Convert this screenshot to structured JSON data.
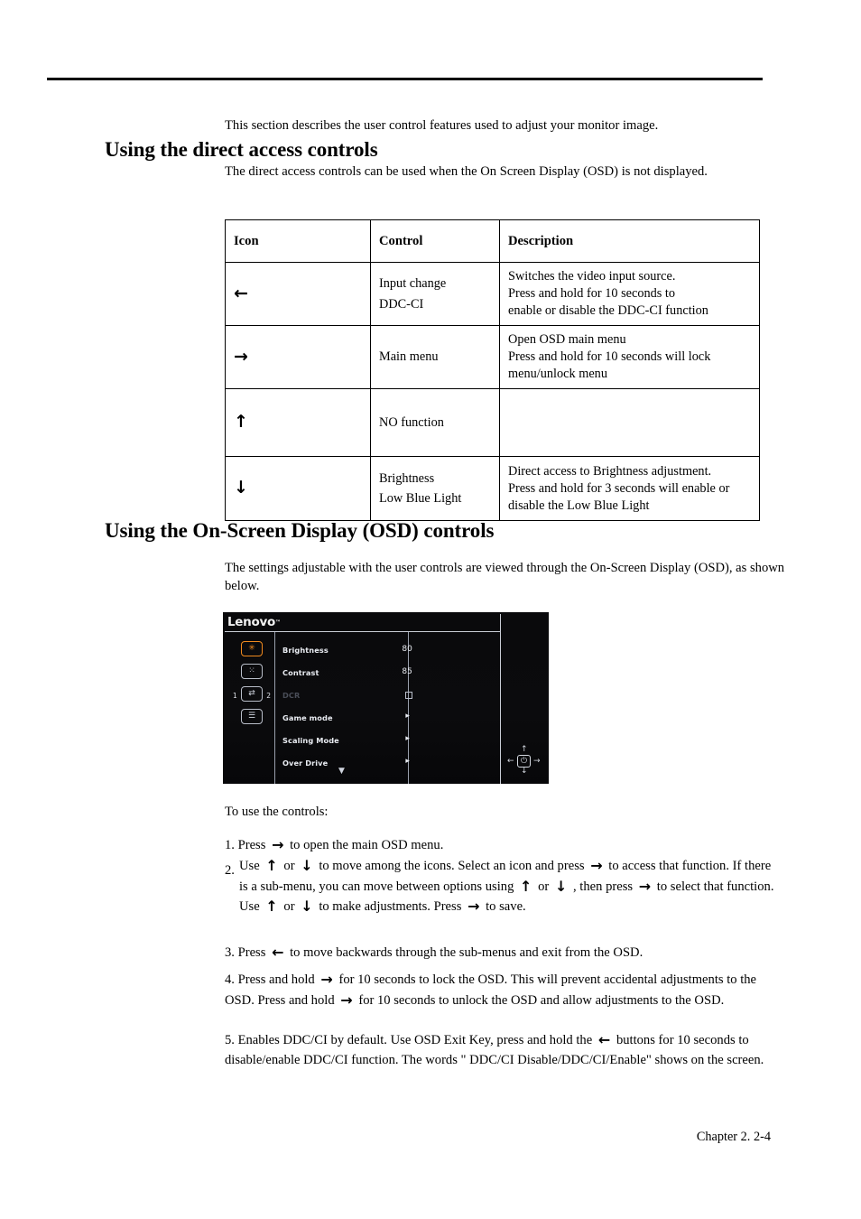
{
  "document": {
    "intro_paragraph": "This section describes the user control features used to adjust your monitor image.",
    "footer": "Chapter 2.  2-4"
  },
  "section_direct_access": {
    "heading": "Using the direct access controls",
    "subtext": "The direct access controls can be used when the On Screen Display (OSD) is not displayed.",
    "table": {
      "headers": [
        "Icon",
        "Control",
        "Description"
      ],
      "rows": [
        {
          "icon": "left-arrow-icon",
          "icon_glyph": "←",
          "control_lines": [
            "Input change",
            "DDC-CI"
          ],
          "description_lines": [
            "Switches the video input source.",
            "Press and hold for 10 seconds to",
            "enable or disable the DDC-CI function"
          ]
        },
        {
          "icon": "right-arrow-icon",
          "icon_glyph": "→",
          "control_lines": [
            "Main menu"
          ],
          "description_lines": [
            "Open OSD main menu",
            "Press and hold for 10 seconds will lock",
            "menu/unlock menu"
          ]
        },
        {
          "icon": "up-arrow-icon",
          "icon_glyph": "↑",
          "control_lines": [
            "NO function"
          ],
          "description_lines": []
        },
        {
          "icon": "down-arrow-icon",
          "icon_glyph": "↓",
          "control_lines": [
            "Brightness",
            "Low Blue Light"
          ],
          "description_lines": [
            "Direct access to Brightness adjustment.",
            "Press and hold for 3 seconds will enable or",
            "disable the Low Blue Light"
          ]
        }
      ]
    }
  },
  "section_osd": {
    "heading": "Using the On-Screen Display (OSD) controls",
    "subtext": "The settings adjustable with the user controls are viewed through the On-Screen Display (OSD), as shown below.",
    "osd_screenshot": {
      "brand": "Lenovo",
      "brand_tm": "™",
      "selected_accent_color": "#f08a1e",
      "side_icons": [
        {
          "name": "brightness-contrast-icon",
          "glyph": "✳",
          "selected": true
        },
        {
          "name": "image-properties-icon",
          "glyph": "⁙",
          "selected": false
        },
        {
          "name": "input-signal-icon",
          "glyph": "⇄",
          "selected": false,
          "left_label": "1",
          "right_label": "2"
        },
        {
          "name": "options-menu-icon",
          "glyph": "☰",
          "selected": false
        }
      ],
      "menu_items": [
        {
          "label": "Brightness",
          "value": "80",
          "type": "value"
        },
        {
          "label": "Contrast",
          "value": "85",
          "type": "value"
        },
        {
          "label": "DCR",
          "value": "",
          "type": "checkbox",
          "dimmed": true
        },
        {
          "label": "Game mode",
          "value": "▸",
          "type": "submenu"
        },
        {
          "label": "Scaling Mode",
          "value": "▸",
          "type": "submenu"
        },
        {
          "label": "Over Drive",
          "value": "▸",
          "type": "submenu"
        }
      ],
      "scroll_down_glyph": "▼",
      "nav": {
        "power_glyph": "⏻",
        "up": "↑",
        "down": "↓",
        "left": "←",
        "right": "→"
      }
    }
  },
  "instructions": {
    "intro": "To use the controls:",
    "step1": {
      "num": "1. Press",
      "icon": "→",
      "rest": "to open the main OSD menu."
    },
    "step2": {
      "num": "2.",
      "t1": "Use",
      "i1": "↑",
      "t2": "or",
      "i2": "↓",
      "t3": "to move among the icons. Select an icon and press",
      "i3": "→",
      "t4": "to access that function. If there is a sub-menu, you can move between options using",
      "i4": "↑",
      "t5": "or",
      "i5": "↓",
      "t6": ", then press",
      "i6": "→",
      "t7": "to select that function. Use",
      "i7": "↑",
      "t8": "or",
      "i8": "↓",
      "t9": "to make adjustments.   Press",
      "i9": "→",
      "t10": "to save."
    },
    "step3": {
      "num": "3. Press",
      "icon": "←",
      "rest": "to move backwards through the sub-menus and exit from the OSD."
    },
    "step4": {
      "num": "4. Press and hold",
      "i1": "→",
      "t1": "for 10 seconds to lock the OSD. This will prevent accidental adjustments to the OSD. Press and hold",
      "i2": "→",
      "t2": "for 10 seconds to unlock the OSD and allow adjustments to the OSD."
    },
    "step5": {
      "num": "5. Enables DDC/CI by default. Use OSD Exit Key, press and hold the",
      "icon": "←",
      "rest": "buttons for 10 seconds to disable/enable DDC/CI function. The words \" DDC/CI Disable/DDC/CI/Enable\" shows on the screen."
    }
  }
}
